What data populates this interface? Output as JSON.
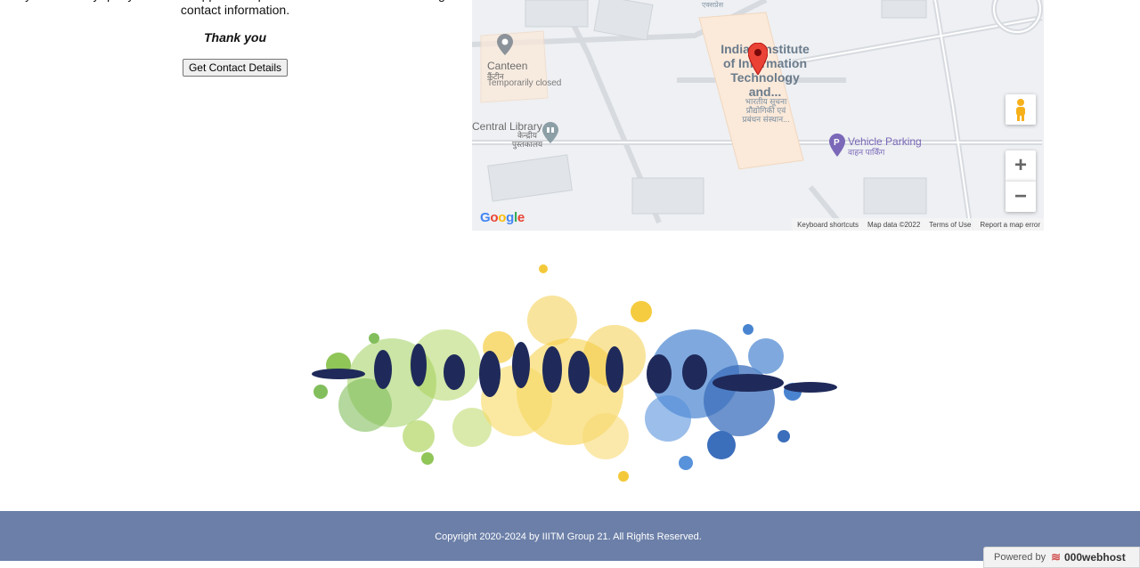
{
  "info": {
    "query_text": "If you have any query about this application please click on below bubtton to get contact information.",
    "thanks": "Thank you",
    "contact_button": "Get Contact Details"
  },
  "map": {
    "top_label": "एक्सप्रेस",
    "main_poi": "Indian Institute of Information Technology and...",
    "main_poi_hindi": "भारतीय सूचना प्रौद्योगिकी एवं प्रबंधन संस्थान...",
    "canteen": "Canteen",
    "canteen_hindi": "कैंटीन",
    "canteen_status": "Temporarily closed",
    "library": "Central Library",
    "library_hindi": "केन्द्रीय पुस्तकालय",
    "parking": "Vehicle Parking",
    "parking_hindi": "वाहन पार्किंग",
    "google": "Google",
    "zoom_in": "+",
    "zoom_out": "−",
    "links": {
      "shortcuts": "Keyboard shortcuts",
      "data": "Map data ©2022",
      "terms": "Terms of Use",
      "report": "Report a map error"
    }
  },
  "footer": {
    "copyright": "Copyright 2020-2024 by IIITM Group 21. All Rights Reserved.",
    "badge_powered": "Powered by",
    "badge_brand": "000webhost"
  },
  "colors": {
    "footer_bg": "#6b7fa8",
    "pin": "#ea4335",
    "parking": "#7b68b8"
  }
}
